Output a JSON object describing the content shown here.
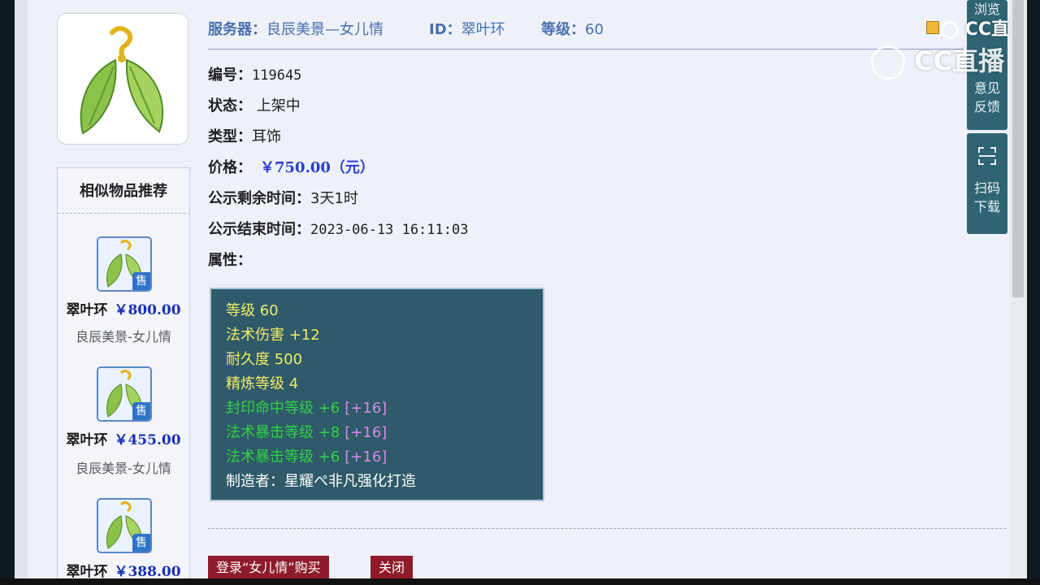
{
  "header": {
    "server_label": "服务器：",
    "server_value": "良辰美景—女儿情",
    "id_label": "ID：",
    "id_value": "翠叶环",
    "level_label": "等级：",
    "level_value": "60"
  },
  "details": {
    "number_label": "编号：",
    "number_value": "119645",
    "status_label": "状态：",
    "status_value": "上架中",
    "type_label": "类型：",
    "type_value": "耳饰",
    "price_label": "价格：",
    "price_value": "￥750.00（元）",
    "remaining_label": "公示剩余时间：",
    "remaining_value": "3天1时",
    "end_label": "公示结束时间：",
    "end_value": "2023-06-13 16:11:03",
    "attr_label": "属性："
  },
  "attributes": {
    "level": "等级 60",
    "magic_damage": "法术伤害 +12",
    "durability": "耐久度 500",
    "refine": "精炼等级 4",
    "seal_hit": "封印命中等级 +6",
    "seal_hit_bonus": "[+16]",
    "crit1": "法术暴击等级 +8",
    "crit1_bonus": "[+16]",
    "crit2": "法术暴击等级 +6",
    "crit2_bonus": "[+16]",
    "maker": "制造者：星耀ぺ非凡强化打造"
  },
  "similar": {
    "title": "相似物品推荐",
    "badge": "售",
    "items": [
      {
        "name": "翠叶环",
        "price": "￥800.00",
        "server": "良辰美景-女儿情"
      },
      {
        "name": "翠叶环",
        "price": "￥455.00",
        "server": "良辰美景-女儿情"
      },
      {
        "name": "翠叶环",
        "price": "￥388.00",
        "server": ""
      }
    ]
  },
  "buttons": {
    "buy": "登录“女儿情”购买",
    "close": "关闭"
  },
  "side_panel": {
    "browse": "浏览",
    "feedback_1": "意见",
    "feedback_2": "反馈",
    "scan_1": "扫码",
    "scan_2": "下载"
  },
  "watermark": {
    "text": "CC直播"
  },
  "colors": {
    "attr_bg": "#2e5a69",
    "price_blue": "#2a3ed0",
    "button_red": "#8e1b2a",
    "side_panel": "#2f6473"
  }
}
